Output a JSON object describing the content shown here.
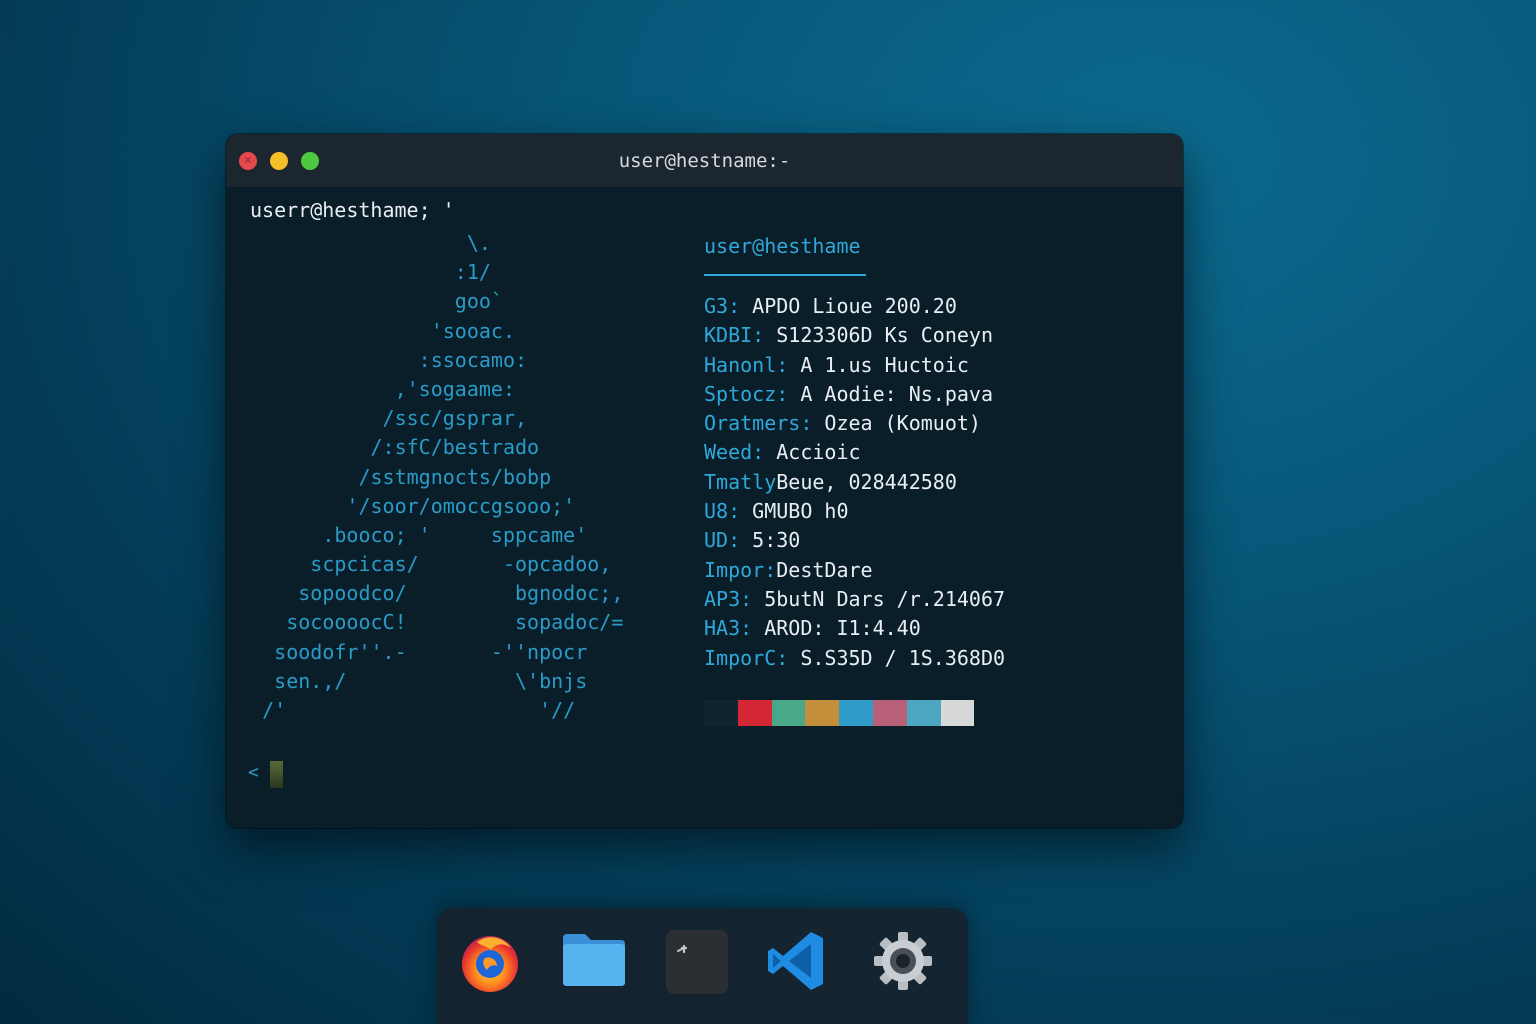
{
  "window": {
    "title": "user@hestname:-"
  },
  "terminal": {
    "prompt": "userr@hesthame; '",
    "logo_lines": [
      "                    \\.",
      "                   :1/",
      "                   goo`",
      "                 'sooac.",
      "                :ssocamo:",
      "              ,'sogaame:",
      "             /ssc/gsprar,",
      "            /:sfC/bestrado",
      "           /sstmgnocts/bobp",
      "          '/soor/omoccgsooo;'",
      "        .booco; '     sppcame'",
      "       scpcicas/       -opcadoo,",
      "      sopoodco/         bgnodoc;,",
      "     socoooocC!         sopadoc/=",
      "    soodofr''.-       -''npocr",
      "    sen.,/              \\'bnjs",
      "   /'                     '//"
    ],
    "cursor_prompt": "<"
  },
  "info": {
    "header": "user@hesthame",
    "rows": [
      {
        "key": "G3: ",
        "value": "APDO Lioue 200.20"
      },
      {
        "key": "KDBI: ",
        "value": "S123306D Ks Coneyn"
      },
      {
        "key": "Hanonl: ",
        "value": "A 1.us Huctoic"
      },
      {
        "key": "Sptocz: ",
        "value": "A Aodie: Ns.pava"
      },
      {
        "key": "Oratmers: ",
        "value": "Ozea (Komuot)"
      },
      {
        "key": "Weed: ",
        "value": "Accioic"
      },
      {
        "key": "Tmatly",
        "value": "Beue, 028442580"
      },
      {
        "key": "U8: ",
        "value": "GMUBO h0"
      },
      {
        "key": "UD: ",
        "value": "5:30"
      },
      {
        "key": "Impor:",
        "value": "DestDare"
      },
      {
        "key": "AP3: ",
        "value": "5butN Dars /r.214067"
      },
      {
        "key": "HA3: ",
        "value": "AROD: I1:4.40"
      },
      {
        "key": "ImporC: ",
        "value": "S.S35D / 1S.368D0"
      }
    ],
    "palette": [
      "#0f2430",
      "#d42734",
      "#4aa88a",
      "#c38f3a",
      "#2f9cc9",
      "#b86078",
      "#4ba6c2",
      "#d7d8d8"
    ]
  },
  "dock": {
    "items": [
      {
        "name": "firefox",
        "icon": "firefox-icon"
      },
      {
        "name": "files",
        "icon": "folder-icon"
      },
      {
        "name": "terminal",
        "icon": "terminal-icon"
      },
      {
        "name": "vscode",
        "icon": "vscode-icon"
      },
      {
        "name": "settings",
        "icon": "gear-icon"
      }
    ]
  }
}
